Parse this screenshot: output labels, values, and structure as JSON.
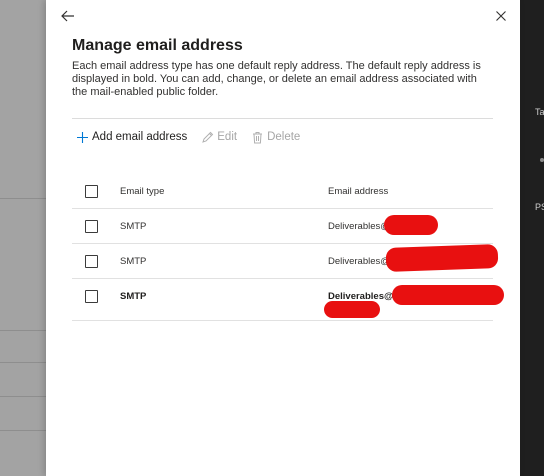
{
  "panel": {
    "title": "Manage email address",
    "description": "Each email address type has one default reply address. The default reply address is displayed in bold. You can add, change, or delete an email address associated with the mail-enabled public folder.",
    "back_icon": "arrow-left-icon",
    "close_icon": "close-icon"
  },
  "toolbar": {
    "add_label": "Add email address",
    "edit_label": "Edit",
    "delete_label": "Delete"
  },
  "table": {
    "headers": {
      "type": "Email type",
      "address": "Email address"
    },
    "rows": [
      {
        "type": "SMTP",
        "address": "Deliverables@",
        "is_default": false
      },
      {
        "type": "SMTP",
        "address": "Deliverables@",
        "is_default": false
      },
      {
        "type": "SMTP",
        "address": "Deliverables@",
        "is_default": true
      }
    ]
  },
  "background": {
    "right_fragments": [
      "Ta",
      "PS"
    ]
  },
  "colors": {
    "accent": "#0078d4",
    "redaction": "#e81010",
    "disabled": "#a6a6a6"
  }
}
